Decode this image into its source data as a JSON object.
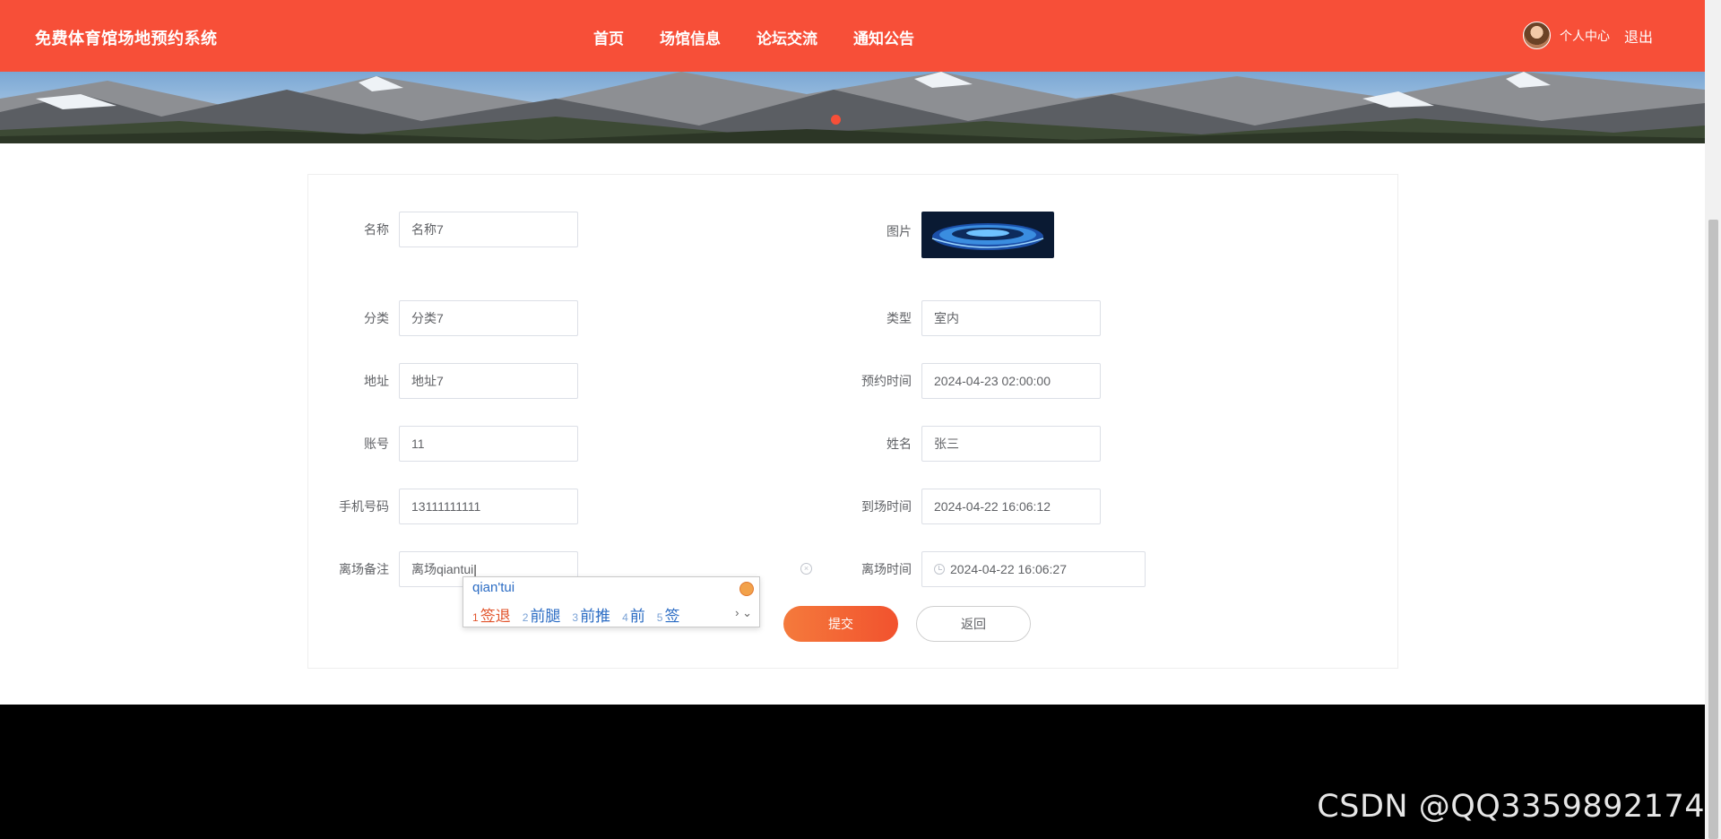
{
  "header": {
    "brand": "免费体育馆场地预约系统",
    "nav": [
      "首页",
      "场馆信息",
      "论坛交流",
      "通知公告"
    ],
    "user_center": "个人中心",
    "logout": "退出",
    "accent": "#f74f38"
  },
  "form": {
    "left": [
      {
        "label": "名称",
        "value": "名称7"
      },
      {
        "label": "分类",
        "value": "分类7"
      },
      {
        "label": "地址",
        "value": "地址7"
      },
      {
        "label": "账号",
        "value": "11"
      },
      {
        "label": "手机号码",
        "value": "13111111111"
      },
      {
        "label": "离场备注",
        "value": "离场qiantui"
      }
    ],
    "right": [
      {
        "label": "图片"
      },
      {
        "label": "类型",
        "value": "室内"
      },
      {
        "label": "预约时间",
        "value": "2024-04-23 02:00:00"
      },
      {
        "label": "姓名",
        "value": "张三"
      },
      {
        "label": "到场时间",
        "value": "2024-04-22 16:06:12"
      },
      {
        "label": "离场时间",
        "value": "2024-04-22 16:06:27"
      }
    ],
    "submit_label": "提交",
    "back_label": "返回"
  },
  "ime": {
    "composition": "qian'tui",
    "candidates": [
      {
        "n": "1",
        "text": "签退"
      },
      {
        "n": "2",
        "text": "前腿"
      },
      {
        "n": "3",
        "text": "前推"
      },
      {
        "n": "4",
        "text": "前"
      },
      {
        "n": "5",
        "text": "签"
      }
    ],
    "more": "› ⌄"
  },
  "watermark": "CSDN @QQ3359892174"
}
